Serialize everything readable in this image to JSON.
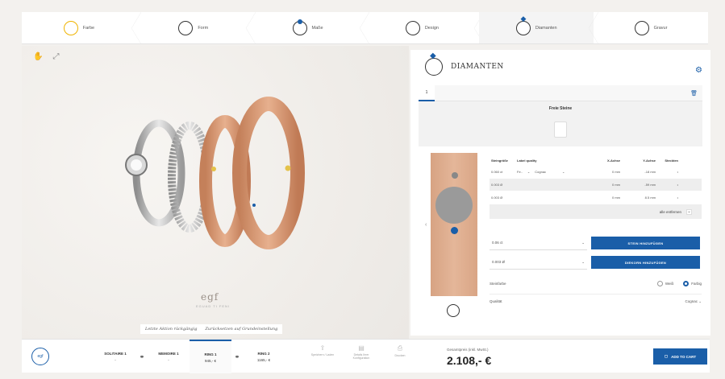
{
  "steps": [
    {
      "label": "Farbe"
    },
    {
      "label": "Form"
    },
    {
      "label": "Maße"
    },
    {
      "label": "Design"
    },
    {
      "label": "Diamanten"
    },
    {
      "label": "Gravur"
    }
  ],
  "stage": {
    "logo": "egf",
    "logo_sub": "EGUAD  TI FENI",
    "action_reset": "Letzte Aktion rückgängig",
    "action_default": "Zurücksetzen auf Grundeinstellung"
  },
  "panel": {
    "title": "DIAMANTEN",
    "tab_label": "1",
    "stone_box_title": "Freie Steine",
    "table_headers": [
      "Steingröße",
      "Label quality",
      "X-Achse",
      "Y-Achse",
      "Steckten"
    ],
    "rows": [
      {
        "size": "0.060 ct",
        "quality": "Fe..",
        "quality2": "Cognac",
        "x": "0",
        "y": "-18",
        "s": "•"
      },
      {
        "size": "0.003 Ø",
        "quality": "",
        "quality2": "",
        "x": "0",
        "y": "-59",
        "s": "•"
      },
      {
        "size": "0.003 Ø",
        "quality": "",
        "quality2": "",
        "x": "0",
        "y": "8.5",
        "s": "•"
      }
    ],
    "unit_mm": "mm",
    "remove_all": "alle entfernen",
    "add_stone_select": "0.06 ct",
    "add_stone_button": "STEIN HINZUFÜGEN",
    "add_grain_select": "0.003 Ø",
    "add_grain_button": "DIEKORN HINZUFÜGEN",
    "color_label": "Steinfarbe",
    "color_opt1": "Weiß",
    "color_opt2": "Farbig",
    "quality_label": "Qualität",
    "quality_value": "Cognac"
  },
  "bottom": {
    "logo": "egf",
    "rings": [
      {
        "name": "SOLITAIRE 1",
        "price": "-"
      },
      {
        "name": "MEMOIRE 1",
        "price": "-"
      },
      {
        "name": "RING 1",
        "price": "945,- €"
      },
      {
        "name": "RING 2",
        "price": "1165,- €"
      }
    ],
    "actions": [
      {
        "label": "Speichern / Laden"
      },
      {
        "label": "Details Ihrer Konfiguration"
      },
      {
        "label": "Drucken"
      }
    ],
    "price_label": "Gesamtpreis (inkl. MwSt.)",
    "price": "2.108,- €",
    "cart_label": "ADD TO CART"
  },
  "colors": {
    "accent": "#1a5ea8",
    "rose_gold": "#d9a585"
  }
}
